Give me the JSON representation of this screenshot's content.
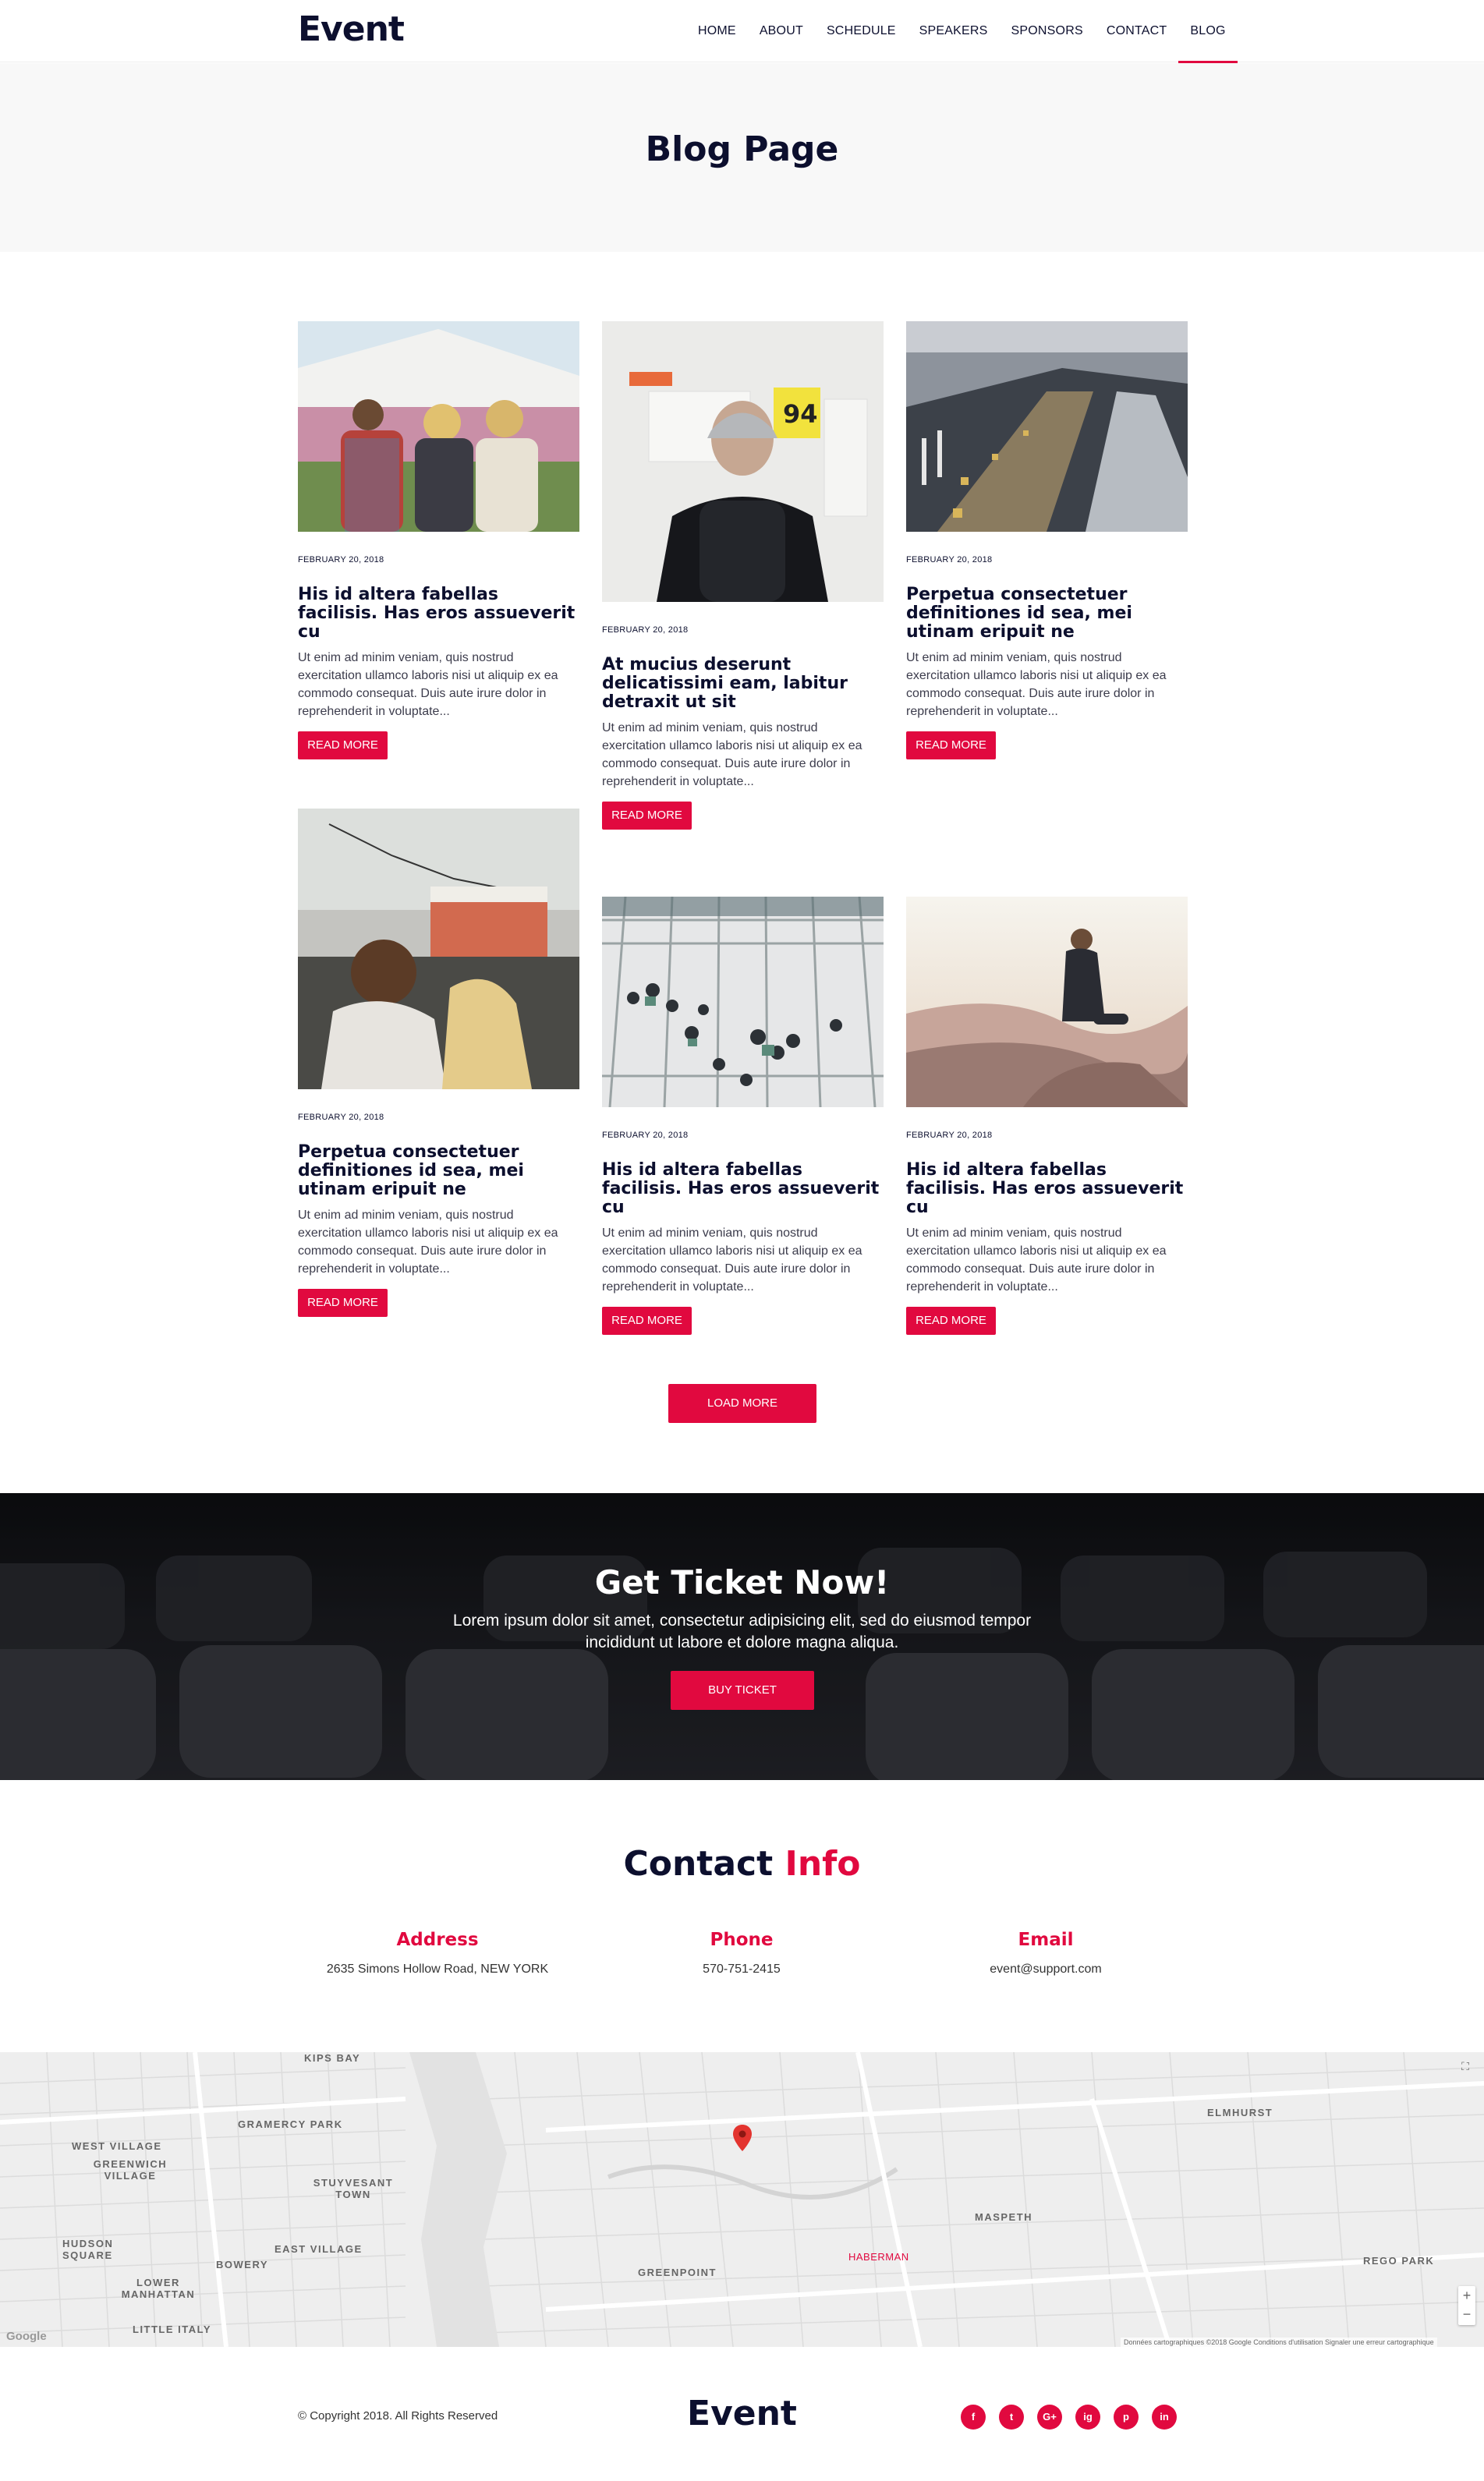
{
  "brand": "Event",
  "nav": [
    "HOME",
    "ABOUT",
    "SCHEDULE",
    "SPEAKERS",
    "SPONSORS",
    "CONTACT",
    "BLOG"
  ],
  "banner_title": "Blog Page",
  "posts": [
    {
      "date": "FEBRUARY 20, 2018",
      "title": "His id altera fabellas facilisis. Has eros assueverit cu",
      "excerpt": "Ut enim ad minim veniam, quis nostrud exercitation ullamco laboris nisi ut aliquip ex ea commodo consequat. Duis aute irure dolor in reprehenderit in voluptate...",
      "button": "READ MORE"
    },
    {
      "date": "FEBRUARY 20, 2018",
      "title": "At mucius deserunt delicatissimi eam, labitur detraxit ut sit",
      "excerpt": "Ut enim ad minim veniam, quis nostrud exercitation ullamco laboris nisi ut aliquip ex ea commodo consequat. Duis aute irure dolor in reprehenderit in voluptate...",
      "button": "READ MORE"
    },
    {
      "date": "FEBRUARY 20, 2018",
      "title": "Perpetua consectetuer definitiones id sea, mei utinam eripuit ne",
      "excerpt": "Ut enim ad minim veniam, quis nostrud exercitation ullamco laboris nisi ut aliquip ex ea commodo consequat. Duis aute irure dolor in reprehenderit in voluptate...",
      "button": "READ MORE"
    },
    {
      "date": "FEBRUARY 20, 2018",
      "title": "Perpetua consectetuer definitiones id sea, mei utinam eripuit ne",
      "excerpt": "Ut enim ad minim veniam, quis nostrud exercitation ullamco laboris nisi ut aliquip ex ea commodo consequat. Duis aute irure dolor in reprehenderit in voluptate...",
      "button": "READ MORE"
    },
    {
      "date": "FEBRUARY 20, 2018",
      "title": "His id altera fabellas facilisis. Has eros assueverit cu",
      "excerpt": "Ut enim ad minim veniam, quis nostrud exercitation ullamco laboris nisi ut aliquip ex ea commodo consequat. Duis aute irure dolor in reprehenderit in voluptate...",
      "button": "READ MORE"
    },
    {
      "date": "FEBRUARY 20, 2018",
      "title": "His id altera fabellas facilisis. Has eros assueverit cu",
      "excerpt": "Ut enim ad minim veniam, quis nostrud exercitation ullamco laboris nisi ut aliquip ex ea commodo consequat. Duis aute irure dolor in reprehenderit in voluptate...",
      "button": "READ MORE"
    }
  ],
  "load_more": "LOAD MORE",
  "cta": {
    "title": "Get Ticket Now!",
    "text": "Lorem ipsum dolor sit amet, consectetur adipisicing elit, sed do eiusmod tempor incididunt ut labore et dolore magna aliqua.",
    "button": "BUY TICKET"
  },
  "contact": {
    "title_a": "Contact",
    "title_b": "Info",
    "address_label": "Address",
    "address": "2635 Simons Hollow Road, NEW YORK",
    "phone_label": "Phone",
    "phone": "570-751-2415",
    "email_label": "Email",
    "email": "event@support.com"
  },
  "map": {
    "labels": [
      "KIPS BAY",
      "WEST VILLAGE",
      "GREENWICH VILLAGE",
      "GRAMERCY PARK",
      "STUYVESANT TOWN",
      "EAST VILLAGE",
      "HUDSON SQUARE",
      "LOWER MANHATTAN",
      "LITTLE ITALY",
      "BOWERY",
      "GREENPOINT",
      "MASPETH",
      "ELMHURST",
      "REGO PARK",
      "Haberman"
    ],
    "google": "Google",
    "attribution": "Données cartographiques ©2018 Google   Conditions d'utilisation   Signaler une erreur cartographique",
    "zoom_in": "+",
    "zoom_out": "−"
  },
  "footer": {
    "copyright": "© Copyright 2018. All Rights Reserved",
    "logo": "Event"
  },
  "social": [
    "f",
    "t",
    "G+",
    "ig",
    "p",
    "in"
  ],
  "colors": {
    "accent": "#e1093f",
    "dark": "#0c0f2e"
  }
}
